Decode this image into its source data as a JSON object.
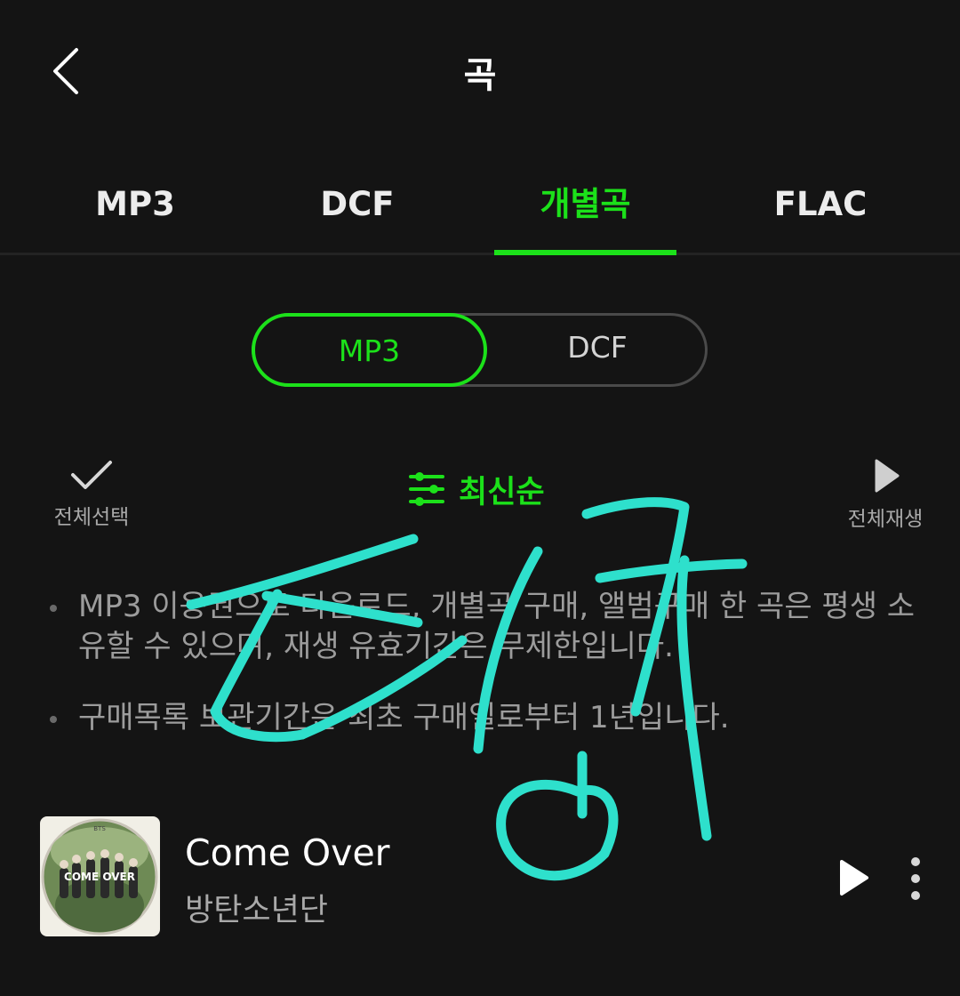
{
  "header": {
    "title": "곡",
    "back_icon": "chevron-left-icon"
  },
  "tabs": [
    {
      "label": "MP3",
      "active": false
    },
    {
      "label": "DCF",
      "active": false
    },
    {
      "label": "개별곡",
      "active": true
    },
    {
      "label": "FLAC",
      "active": false
    }
  ],
  "segment": {
    "mp3_label": "MP3",
    "dcf_label": "DCF",
    "selected": "MP3"
  },
  "toolbar": {
    "select_all_label": "전체선택",
    "select_all_icon": "check-icon",
    "sort_label": "최신순",
    "sort_icon": "sliders-icon",
    "play_all_label": "전체재생",
    "play_all_icon": "play-icon"
  },
  "notices": [
    "MP3 이용권으로 다운로드, 개별곡 구매, 앨범구매 한 곡은 평생 소유할 수 있으며, 재생 유효기간은 무제한입니다.",
    "구매목록 보관기간은 최초 구매일로부터 1년입니다."
  ],
  "track": {
    "title": "Come Over",
    "artist": "방탄소년단",
    "album_art_text": "COME OVER",
    "album_art_top_text": "BTS"
  },
  "colors": {
    "accent": "#1ce11a",
    "background": "#141414",
    "scribble": "#2ee0cc"
  }
}
